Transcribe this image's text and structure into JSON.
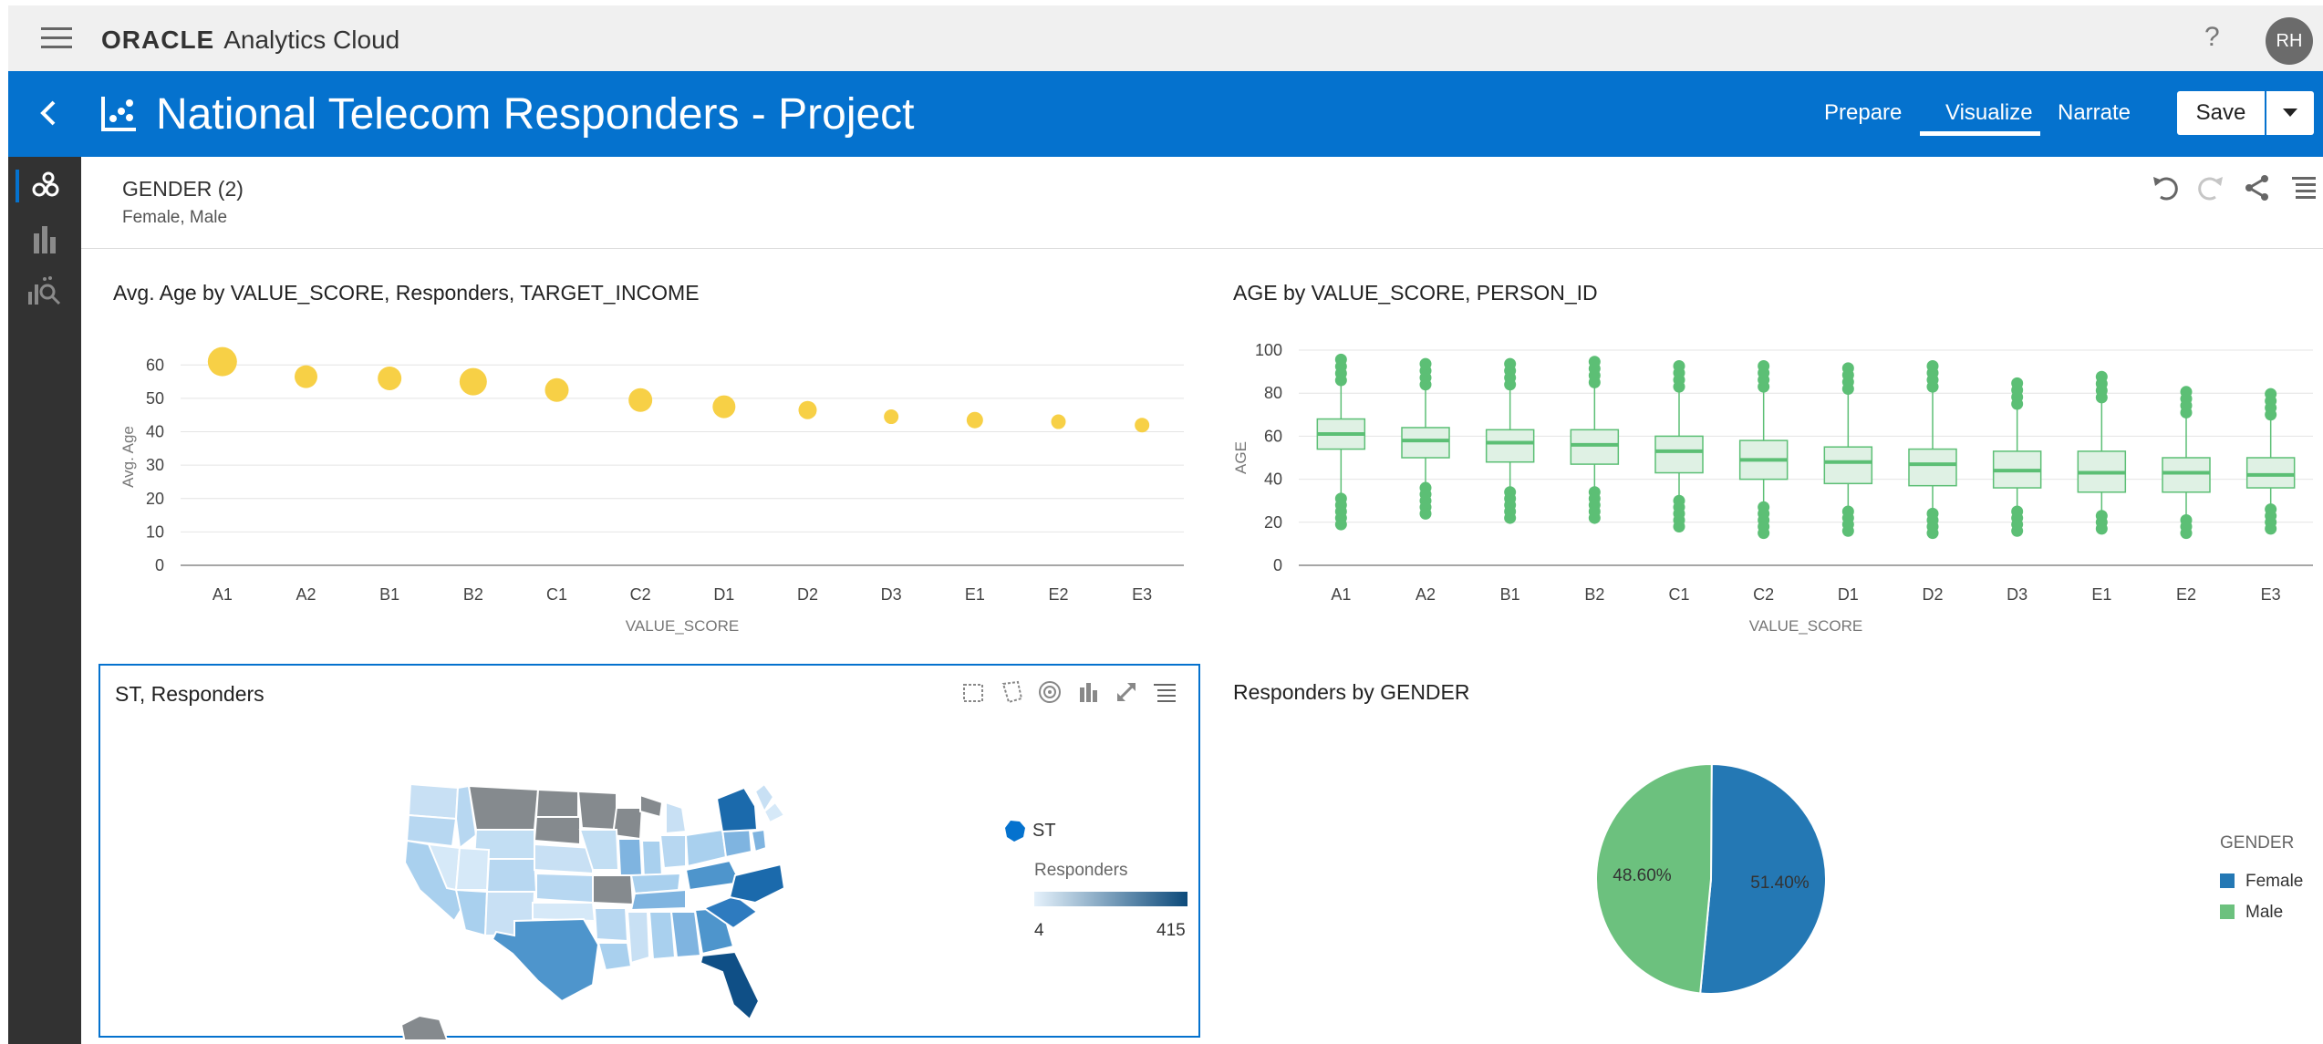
{
  "app": {
    "brand_oracle": "ORACLE",
    "brand_product": "Analytics Cloud",
    "help": "?",
    "user_initials": "RH"
  },
  "project": {
    "title": "National Telecom Responders - Project",
    "tabs": [
      "Prepare",
      "Visualize",
      "Narrate"
    ],
    "active_tab": "Visualize",
    "save_label": "Save"
  },
  "filter": {
    "title": "GENDER (2)",
    "values": "Female, Male"
  },
  "colors": {
    "accent": "#0572ce",
    "bubble": "#f7d046",
    "box": "#5cbf75",
    "female": "#2478b4",
    "male": "#6cc17e"
  },
  "panels": {
    "scatter_title": "Avg. Age by VALUE_SCORE, Responders, TARGET_INCOME",
    "box_title": "AGE by VALUE_SCORE, PERSON_ID",
    "map_title": "ST, Responders",
    "pie_title": "Responders by GENDER"
  },
  "map": {
    "legend_category": "ST",
    "legend_measure": "Responders",
    "legend_min": "4",
    "legend_max": "415"
  },
  "chart_data": [
    {
      "type": "scatter",
      "title": "Avg. Age by VALUE_SCORE, Responders, TARGET_INCOME",
      "xlabel": "VALUE_SCORE",
      "ylabel": "Avg. Age",
      "categories": [
        "A1",
        "A2",
        "B1",
        "B2",
        "C1",
        "C2",
        "D1",
        "D2",
        "D3",
        "E1",
        "E2",
        "E3"
      ],
      "values": [
        61,
        56.5,
        56,
        55,
        52.5,
        49.5,
        47.5,
        46.5,
        44.5,
        43.5,
        43,
        42
      ],
      "yticks": [
        0,
        10,
        20,
        30,
        40,
        50,
        60
      ],
      "ylim": [
        0,
        65
      ],
      "grid": true
    },
    {
      "type": "box",
      "title": "AGE by VALUE_SCORE, PERSON_ID",
      "xlabel": "VALUE_SCORE",
      "ylabel": "AGE",
      "categories": [
        "A1",
        "A2",
        "B1",
        "B2",
        "C1",
        "C2",
        "D1",
        "D2",
        "D3",
        "E1",
        "E2",
        "E3"
      ],
      "median": [
        61,
        58,
        57,
        56,
        53,
        49,
        48,
        47,
        44,
        43,
        43,
        42
      ],
      "q1": [
        54,
        50,
        48,
        47,
        43,
        40,
        38,
        37,
        36,
        34,
        34,
        36
      ],
      "q3": [
        68,
        64,
        63,
        63,
        60,
        58,
        55,
        54,
        53,
        53,
        50,
        50
      ],
      "whisker_low": [
        33,
        38,
        36,
        36,
        32,
        29,
        27,
        26,
        27,
        25,
        23,
        28
      ],
      "whisker_high": [
        84,
        82,
        82,
        83,
        81,
        81,
        80,
        81,
        73,
        76,
        69,
        68
      ],
      "yticks": [
        0,
        20,
        40,
        60,
        80,
        100
      ],
      "ylim": [
        0,
        100
      ],
      "grid": true
    },
    {
      "type": "pie",
      "title": "Responders by GENDER",
      "legend_title": "GENDER",
      "slices": [
        {
          "name": "Female",
          "value": 51.4,
          "label": "51.40%"
        },
        {
          "name": "Male",
          "value": 48.6,
          "label": "48.60%"
        }
      ],
      "legend_position": "right"
    }
  ]
}
